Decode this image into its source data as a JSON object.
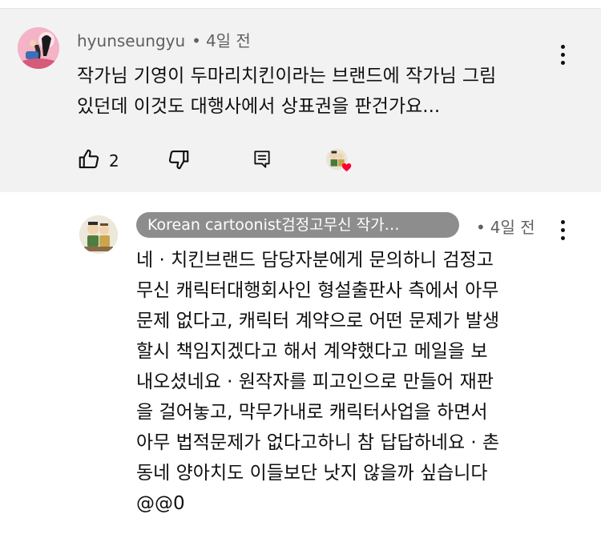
{
  "comment": {
    "author": "hyunseungyu",
    "time": "4일 전",
    "separator": "•",
    "lines": [
      "작가님 기영이 두마리치킨이라는 브랜드에 작가님 그림",
      "있던데 이것도 대행사에서 상표권을 판건가요..."
    ],
    "like_count": "2",
    "icons": [
      "thumbs-up-icon",
      "thumbs-down-icon",
      "reply-icon",
      "creator-heart-icon",
      "more-vert-icon"
    ]
  },
  "reply": {
    "author": "Korean cartoonist검정고무신 작가…",
    "time": "4일 전",
    "separator": "•",
    "lines": [
      "네 · 치킨브랜드 담당자분에게 문의하니 검정고",
      "무신 캐릭터대행회사인 형설출판사 측에서 아무",
      "문제 없다고, 캐릭터 계약으로 어떤 문제가 발생",
      "할시 책임지겠다고  해서 계약했다고 메일을 보",
      "내오셨네요 · 원작자를 피고인으로 만들어 재판",
      "을 걸어놓고, 막무가내로 캐릭터사업을 하면서",
      "아무 법적문제가 없다고하니 참 답답하네요 · 촌",
      "동네 양아치도 이들보단 낫지 않을까 싶습니다",
      "@@0"
    ]
  },
  "colors": {
    "comment_bg": "#f2f2f2",
    "chip_bg": "#8d8d8d",
    "meta_text": "#606060",
    "heart": "#ff0033"
  }
}
